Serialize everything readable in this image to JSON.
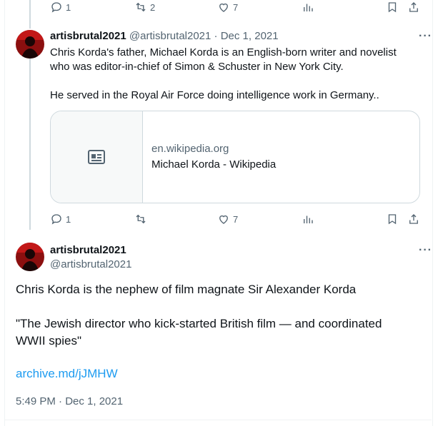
{
  "top_actions": {
    "reply_count": "1",
    "retweet_count": "2",
    "like_count": "7"
  },
  "tweet1": {
    "name": "artisbrutal2021",
    "handle": "@artisbrutal2021",
    "date": "· Dec 1, 2021",
    "more": "···",
    "line1": "Chris Korda's father, Michael Korda is an English-born writer and novelist",
    "line2": "who was editor-in-chief of Simon & Schuster in New York City.",
    "line3": "He served in the Royal Air Force doing intelligence work in Germany..",
    "card": {
      "domain": "en.wikipedia.org",
      "title": "Michael Korda - Wikipedia"
    },
    "actions": {
      "reply_count": "1",
      "retweet_count": "",
      "like_count": "7"
    }
  },
  "tweet2": {
    "name": "artisbrutal2021",
    "handle": "@artisbrutal2021",
    "more": "···",
    "para1": "Chris Korda is the nephew of film magnate Sir Alexander Korda",
    "para2_line1": "\"The Jewish director who kick-started British film — and coordinated",
    "para2_line2": "WWII spies\"",
    "link": "archive.md/jJMHW",
    "timestamp": "5:49 PM · Dec 1, 2021"
  },
  "icons": {
    "reply": "reply-icon",
    "retweet": "retweet-icon",
    "like": "heart-icon",
    "views": "views-icon",
    "bookmark": "bookmark-icon",
    "share": "share-icon",
    "card": "article-icon"
  },
  "colors": {
    "link": "#1d9bf0",
    "muted": "#536471",
    "text": "#0f1419",
    "border": "#cfd9de"
  }
}
